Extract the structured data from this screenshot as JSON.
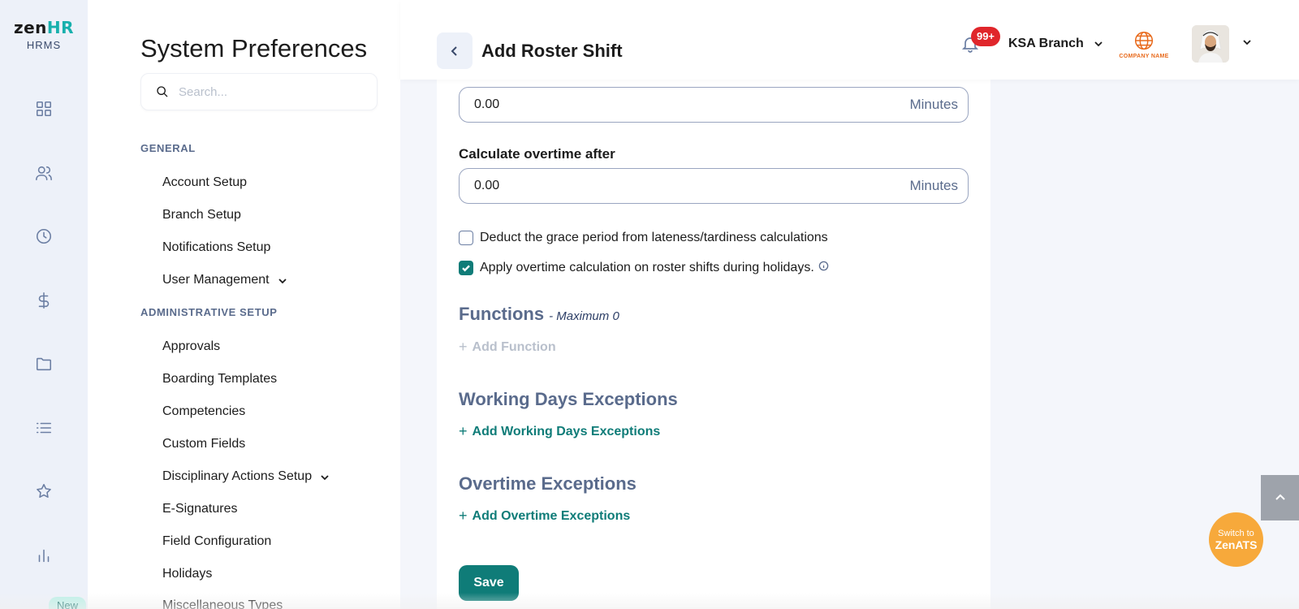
{
  "logo": {
    "brand_a": "zen",
    "brand_b": "HR",
    "sub": "HRMS"
  },
  "rail": {
    "icons": [
      "dashboard-icon",
      "people-icon",
      "clock-icon",
      "dollar-icon",
      "folder-icon",
      "list-icon",
      "star-icon",
      "chart-icon"
    ],
    "new_badge": "New"
  },
  "sidebar": {
    "title": "System Preferences",
    "search_placeholder": "Search...",
    "sections": [
      {
        "label": "GENERAL"
      },
      {
        "label": "ADMINISTRATIVE SETUP"
      }
    ],
    "general_items": [
      {
        "label": "Account Setup"
      },
      {
        "label": "Branch Setup"
      },
      {
        "label": "Notifications Setup"
      },
      {
        "label": "User Management"
      }
    ],
    "admin_items": [
      {
        "label": "Approvals"
      },
      {
        "label": "Boarding Templates"
      },
      {
        "label": "Competencies"
      },
      {
        "label": "Custom Fields"
      },
      {
        "label": "Disciplinary Actions Setup"
      },
      {
        "label": "E-Signatures"
      },
      {
        "label": "Field Configuration"
      },
      {
        "label": "Holidays"
      },
      {
        "label": "Miscellaneous Types"
      }
    ]
  },
  "header": {
    "title": "Add Roster Shift",
    "notification_count": "99+",
    "branch": "KSA Branch",
    "company_logo_text": "COMPANY NAME"
  },
  "form": {
    "field1": {
      "value": "0.00",
      "unit": "Minutes"
    },
    "field2": {
      "label": "Calculate overtime after",
      "value": "0.00",
      "unit": "Minutes"
    },
    "check1": {
      "label": "Deduct the grace period from lateness/tardiness calculations",
      "checked": false
    },
    "check2": {
      "label": "Apply overtime calculation on roster shifts during holidays.",
      "checked": true
    },
    "functions": {
      "title": "Functions",
      "subtitle": "- Maximum 0",
      "add": "Add Function"
    },
    "working_days": {
      "title": "Working Days Exceptions",
      "add": "Add Working Days Exceptions"
    },
    "overtime": {
      "title": "Overtime Exceptions",
      "add": "Add Overtime Exceptions"
    },
    "save": "Save"
  },
  "floating": {
    "ats_line1": "Switch to",
    "ats_line2": "ZenATS"
  },
  "colors": {
    "accent": "#0f7c78",
    "badge": "#e0262b",
    "ats": "#f7a93b",
    "section": "#5a6b8c"
  }
}
